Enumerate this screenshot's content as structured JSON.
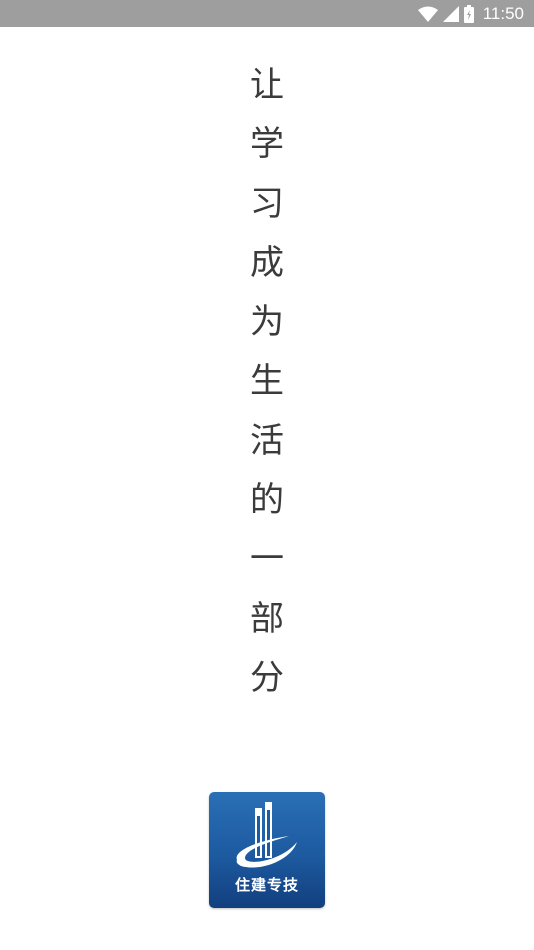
{
  "status_bar": {
    "time": "11:50",
    "icons": [
      "wifi-icon",
      "cell-signal-icon",
      "battery-icon"
    ]
  },
  "splash": {
    "slogan": [
      "让",
      "学",
      "习",
      "成",
      "为",
      "生",
      "活",
      "的",
      "一",
      "部",
      "分"
    ]
  },
  "app_logo": {
    "text": "住建专技",
    "background_color": "#1d5aa0"
  }
}
